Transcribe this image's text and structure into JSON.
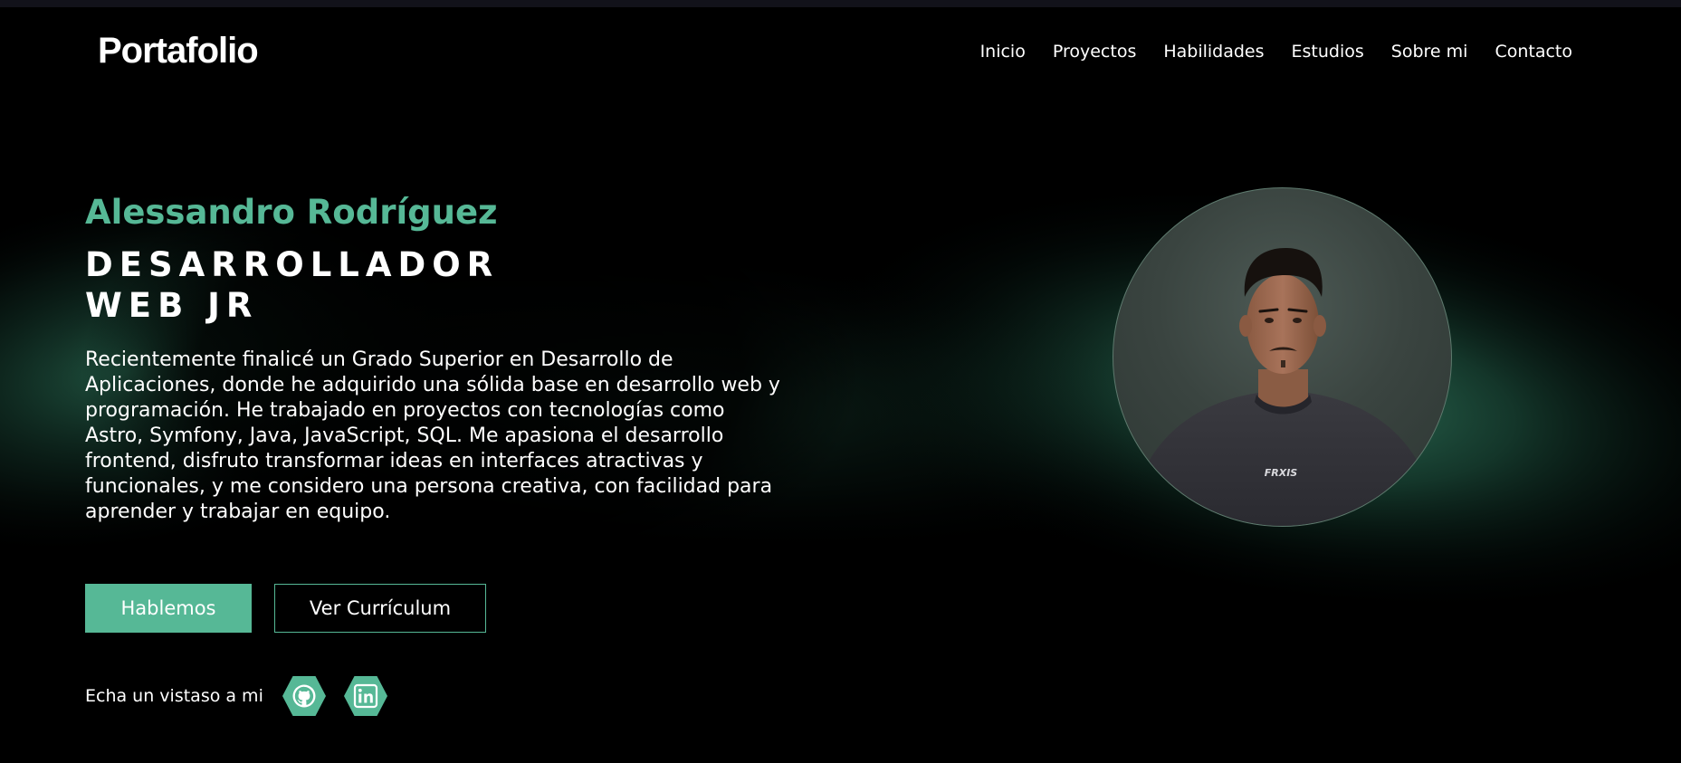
{
  "header": {
    "logo": "Portafolio",
    "nav": [
      {
        "label": "Inicio"
      },
      {
        "label": "Proyectos"
      },
      {
        "label": "Habilidades"
      },
      {
        "label": "Estudios"
      },
      {
        "label": "Sobre mi"
      },
      {
        "label": "Contacto"
      }
    ]
  },
  "hero": {
    "name": "Alessandro Rodríguez",
    "role_line1": "DESARROLLADOR",
    "role_line2": "WEB JR",
    "description": "Recientemente finalicé un Grado Superior en Desarrollo de Aplicaciones, donde he adquirido una sólida base en desarrollo web y programación. He trabajado en proyectos con tecnologías como Astro, Symfony, Java, JavaScript, SQL. Me apasiona el desarrollo frontend, disfruto transformar ideas en interfaces atractivas y funcionales, y me considero una persona creativa, con facilidad para aprender y trabajar en equipo.",
    "primary_button": "Hablemos",
    "secondary_button": "Ver Currículum"
  },
  "social": {
    "label": "Echa un vistaso a mi",
    "icons": [
      "github-icon",
      "linkedin-icon"
    ]
  },
  "colors": {
    "accent": "#56b896",
    "background": "#000000",
    "text": "#ffffff"
  }
}
